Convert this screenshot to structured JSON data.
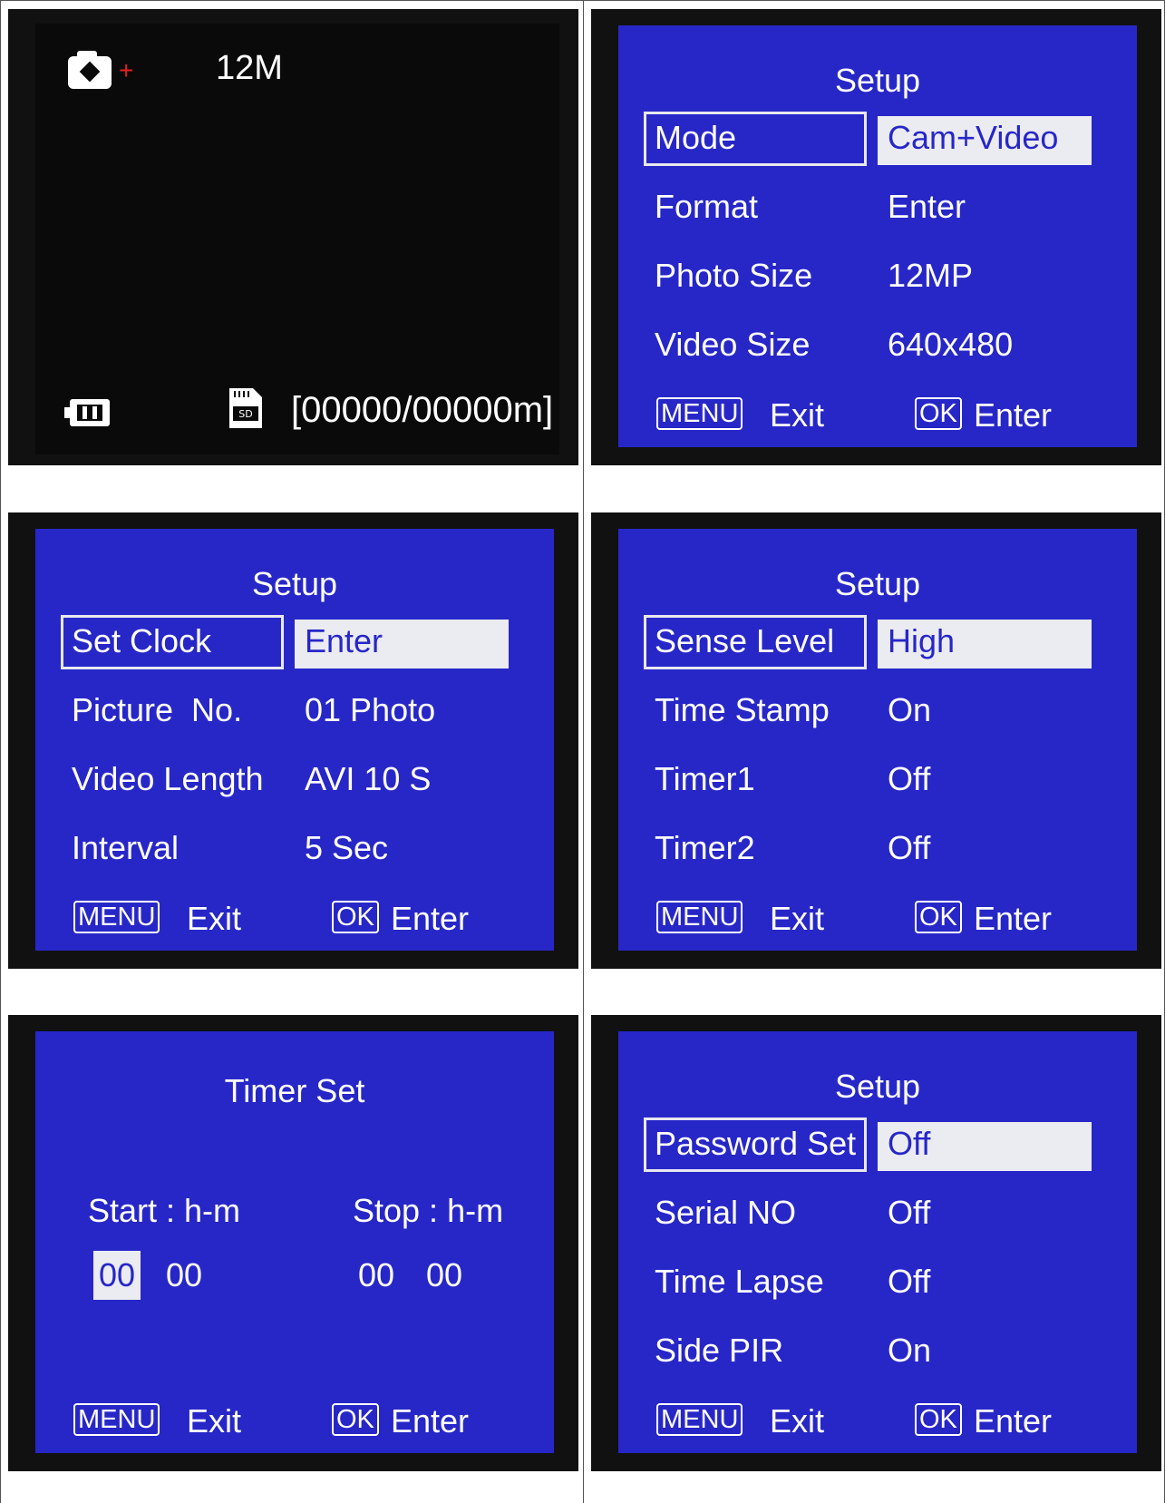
{
  "colors": {
    "screen_bg": "#2727c8",
    "highlight_bg": "#ebebf2",
    "dark_bg": "#0a0a0a",
    "accent_red": "#e02020"
  },
  "live_view": {
    "resolution": "12M",
    "counter": "[00000/00000m]",
    "icons": [
      "camera-icon",
      "battery-icon",
      "sd-card-icon"
    ],
    "sd_label": "SD"
  },
  "menu1": {
    "title": "Setup",
    "rows": [
      {
        "label": "Mode",
        "value": "Cam+Video"
      },
      {
        "label": "Format",
        "value": "Enter"
      },
      {
        "label": "Photo Size",
        "value": "12MP"
      },
      {
        "label": "Video Size",
        "value": "640x480"
      }
    ]
  },
  "menu2": {
    "title": "Setup",
    "rows": [
      {
        "label": "Set Clock",
        "value": "Enter"
      },
      {
        "label": "Picture  No.",
        "value": "01 Photo"
      },
      {
        "label": "Video Length",
        "value": "AVI 10 S"
      },
      {
        "label": "Interval",
        "value": "5 Sec"
      }
    ]
  },
  "menu3": {
    "title": "Setup",
    "rows": [
      {
        "label": "Sense Level",
        "value": "High"
      },
      {
        "label": "Time Stamp",
        "value": "On"
      },
      {
        "label": "Timer1",
        "value": "Off"
      },
      {
        "label": "Timer2",
        "value": "Off"
      }
    ]
  },
  "timer": {
    "title": "Timer Set",
    "start_label": "Start : h-m",
    "stop_label": "Stop : h-m",
    "start_h": "00",
    "start_m": "00",
    "stop_h": "00",
    "stop_m": "00"
  },
  "menu4": {
    "title": "Setup",
    "rows": [
      {
        "label": "Password Set",
        "value": "Off"
      },
      {
        "label": "Serial NO",
        "value": "Off"
      },
      {
        "label": "Time Lapse",
        "value": "Off"
      },
      {
        "label": "Side PIR",
        "value": "On"
      }
    ]
  },
  "footer": {
    "menu_key": "MENU",
    "exit": "Exit",
    "ok_key": "OK",
    "enter": "Enter"
  }
}
